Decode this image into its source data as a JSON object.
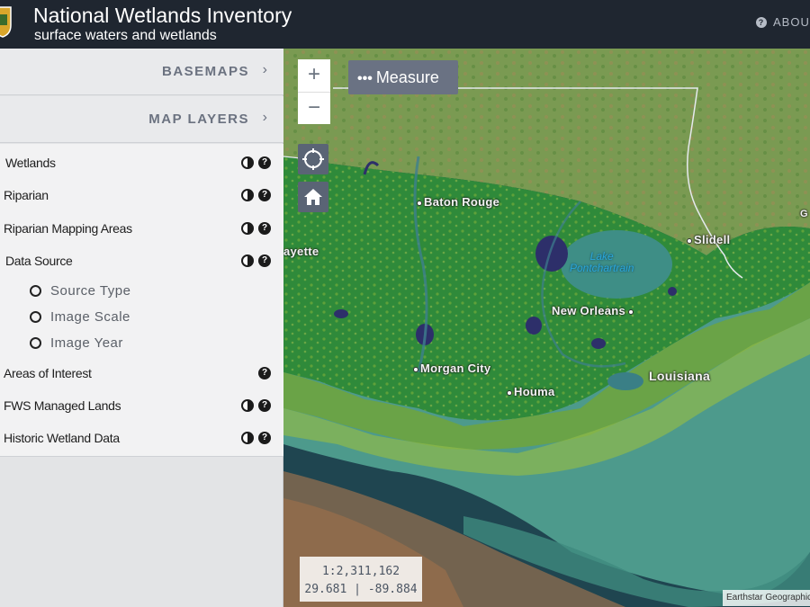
{
  "header": {
    "title": "National Wetlands Inventory",
    "subtitle": "surface waters and wetlands",
    "about_label": "ABOUT"
  },
  "sidebar": {
    "basemaps_label": "BASEMAPS",
    "map_layers_label": "MAP LAYERS",
    "layers": [
      {
        "label": "Wetlands",
        "icons": [
          "opacity-icon",
          "help-icon"
        ]
      },
      {
        "label": "Riparian",
        "icons": [
          "opacity-icon",
          "help-icon"
        ]
      },
      {
        "label": "Riparian Mapping Areas",
        "icons": [
          "opacity-icon",
          "help-icon"
        ]
      },
      {
        "label": "Data Source",
        "icons": [
          "opacity-icon",
          "help-icon"
        ]
      },
      {
        "label": "Areas of Interest",
        "icons": [
          "help-icon"
        ]
      },
      {
        "label": "FWS Managed Lands",
        "icons": [
          "opacity-icon",
          "help-icon"
        ]
      },
      {
        "label": "Historic Wetland Data",
        "icons": [
          "opacity-icon",
          "help-icon"
        ]
      }
    ],
    "data_source_options": [
      "Source Type",
      "Image Scale",
      "Image Year"
    ]
  },
  "map": {
    "zoom_in": "+",
    "zoom_out": "−",
    "measure_label": "Measure",
    "measure_dots": "•••",
    "scale": "1:2,311,162",
    "coordinates": "29.681 | -89.884",
    "attribution": "Earthstar Geographics",
    "places": {
      "baton_rouge": "Baton Rouge",
      "slidell": "Slidell",
      "lafayette": "ayette",
      "new_orleans": "New Orleans",
      "morgan_city": "Morgan City",
      "houma": "Houma",
      "louisiana": "Louisiana",
      "lake_1": "Lake",
      "lake_2": "Pontchartrain",
      "edge_label": "G"
    }
  },
  "colors": {
    "header_bg": "#1f2630",
    "wetland_green": "#2f8a3a",
    "water_teal": "#3f8a7e",
    "ocean": "#1d3d4a"
  }
}
